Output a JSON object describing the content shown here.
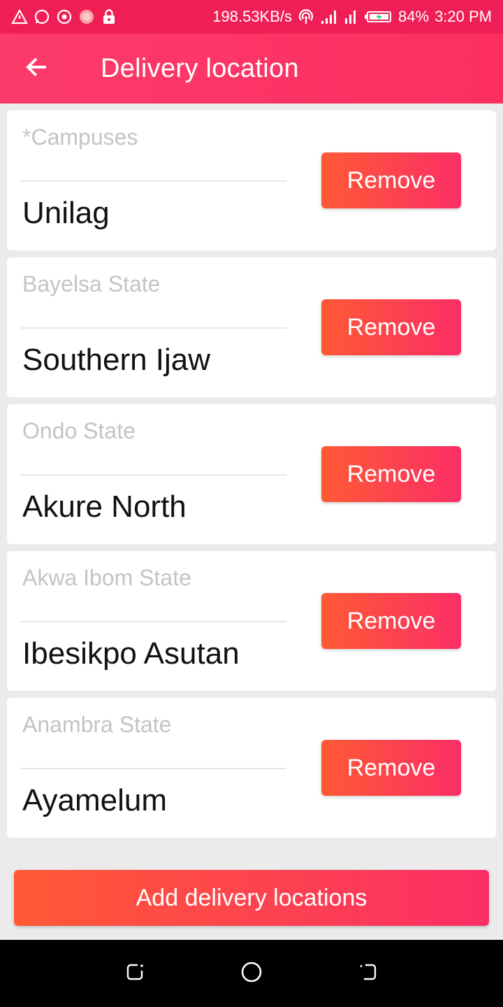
{
  "status_bar": {
    "speed": "198.53KB/s",
    "battery": "84%",
    "time": "3:20 PM"
  },
  "app_bar": {
    "title": "Delivery location"
  },
  "locations": [
    {
      "label": "*Campuses",
      "value": "Unilag",
      "action": "Remove"
    },
    {
      "label": "Bayelsa State",
      "value": "Southern Ijaw",
      "action": "Remove"
    },
    {
      "label": "Ondo State",
      "value": "Akure North",
      "action": "Remove"
    },
    {
      "label": "Akwa Ibom State",
      "value": "Ibesikpo Asutan",
      "action": "Remove"
    },
    {
      "label": "Anambra State",
      "value": "Ayamelum",
      "action": "Remove"
    }
  ],
  "footer": {
    "add_label": "Add delivery locations"
  },
  "colors": {
    "status_bar": "#ef1f56",
    "app_bar": "#fc3b6b",
    "button_start": "#ff5a35",
    "button_end": "#fb2e66"
  }
}
